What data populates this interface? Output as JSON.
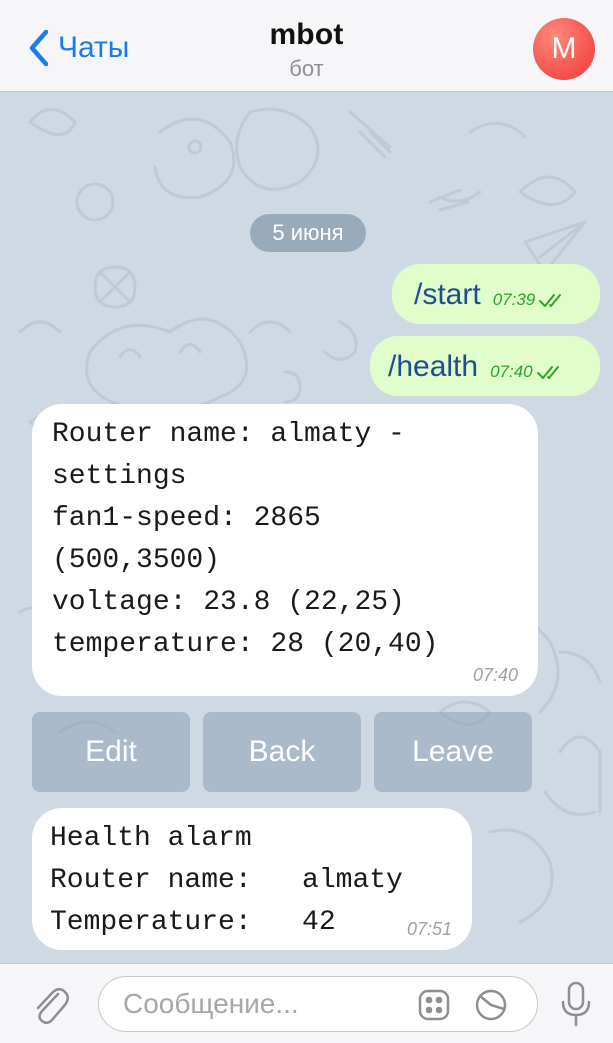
{
  "header": {
    "back_label": "Чаты",
    "title": "mbot",
    "subtitle": "бот",
    "avatar_letter": "M"
  },
  "chat": {
    "date_label": "5 июня",
    "outgoing": [
      {
        "text": "/start",
        "time": "07:39"
      },
      {
        "text": "/health",
        "time": "07:40"
      }
    ],
    "incoming": [
      {
        "lines": [
          "Router name: almaty -",
          "settings",
          "fan1-speed: 2865",
          "(500,3500)",
          "voltage: 23.8 (22,25)",
          "temperature: 28 (20,40)"
        ],
        "time": "07:40"
      },
      {
        "lines": [
          "Health alarm",
          "Router name:   almaty",
          "Temperature:   42"
        ],
        "time": "07:51"
      }
    ],
    "keyboard_buttons": [
      "Edit",
      "Back",
      "Leave"
    ]
  },
  "input": {
    "placeholder": "Сообщение..."
  },
  "colors": {
    "accent": "#1a7bea",
    "outgoing_bubble": "#e1fdca",
    "incoming_bubble": "#ffffff",
    "read_check": "#2aa62a",
    "avatar": "#f24e4a"
  },
  "icons": [
    "chevron-left-icon",
    "paperclip-icon",
    "sticker-icon",
    "clock-icon",
    "microphone-icon",
    "double-check-icon"
  ]
}
